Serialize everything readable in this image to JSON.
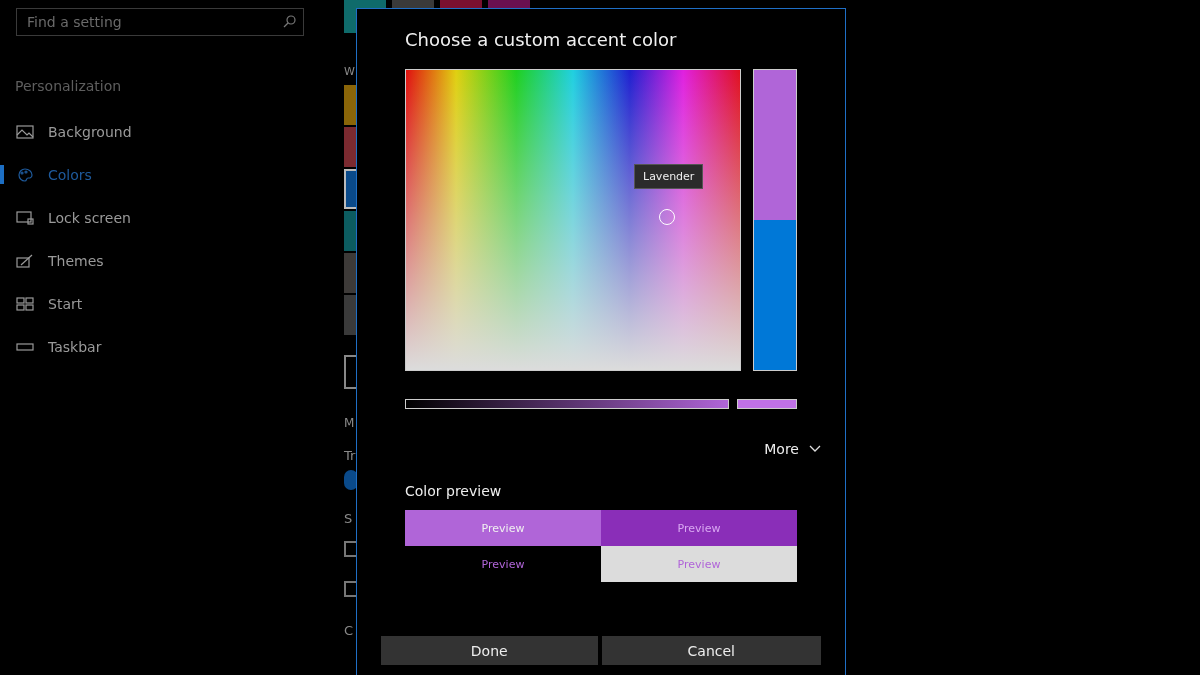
{
  "sidebar": {
    "search": {
      "placeholder": "Find a setting"
    },
    "section": "Personalization",
    "items": [
      {
        "label": "Background",
        "selected": false
      },
      {
        "label": "Colors",
        "selected": true
      },
      {
        "label": "Lock screen",
        "selected": false
      },
      {
        "label": "Themes",
        "selected": false
      },
      {
        "label": "Start",
        "selected": false
      },
      {
        "label": "Taskbar",
        "selected": false
      }
    ]
  },
  "background_page": {
    "top_swatches": [
      {
        "color": "#0f6b6b"
      },
      {
        "color": "#3a3a3a"
      },
      {
        "color": "#7a1030"
      },
      {
        "color": "#6a1050"
      }
    ],
    "heading_1": "W",
    "swatches": [
      {
        "color": "#8a6508",
        "selected": false
      },
      {
        "color": "#7b2a30",
        "selected": false
      },
      {
        "color": "#0a4a8a",
        "selected": true
      },
      {
        "color": "#0c5c60",
        "selected": false
      },
      {
        "color": "#3d3a38",
        "selected": false
      },
      {
        "color": "#3a3a3a",
        "selected": false
      }
    ],
    "heading_2": "M",
    "label_1": "Tr",
    "toggle": {
      "on": true
    },
    "label_2": "S",
    "checkboxes": [
      {
        "checked": false
      },
      {
        "checked": false
      }
    ],
    "label_3": "C"
  },
  "dialog": {
    "title": "Choose a custom accent color",
    "tooltip": "Lavender",
    "brightness": {
      "level": 1
    },
    "more": "More",
    "preview_label": "Color preview",
    "previews": [
      {
        "label": "Preview",
        "kind": "light-fill"
      },
      {
        "label": "Preview",
        "kind": "dark-fill"
      },
      {
        "label": "Preview",
        "kind": "on-black"
      },
      {
        "label": "Preview",
        "kind": "on-white"
      }
    ],
    "buttons": [
      {
        "label": "Done"
      },
      {
        "label": "Cancel"
      }
    ]
  }
}
